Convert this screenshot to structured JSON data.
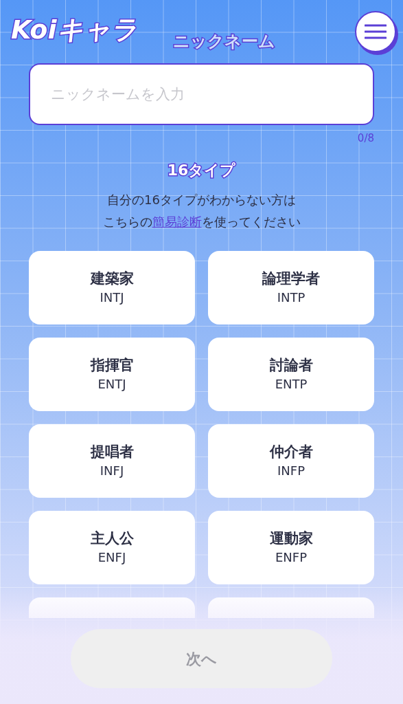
{
  "header": {
    "logo": "Koiキャラ",
    "title": "ニックネーム"
  },
  "nickname": {
    "placeholder": "ニックネームを入力",
    "counter": "0/8"
  },
  "type_section": {
    "title": "16タイプ",
    "line_1": "自分の16タイプがわからない方は",
    "line_2_before": "こちらの",
    "link": "簡易診断",
    "line_2_after": "を使ってください"
  },
  "types": [
    {
      "kind": "card",
      "name": "建築家",
      "code": "INTJ",
      "selected": false
    },
    {
      "kind": "card",
      "name": "論理学者",
      "code": "INTP",
      "selected": false
    },
    {
      "kind": "card",
      "name": "指揮官",
      "code": "ENTJ",
      "selected": false
    },
    {
      "kind": "card",
      "name": "討論者",
      "code": "ENTP",
      "selected": false
    },
    {
      "kind": "card",
      "name": "提唱者",
      "code": "INFJ",
      "selected": false
    },
    {
      "kind": "card",
      "name": "仲介者",
      "code": "INFP",
      "selected": false
    },
    {
      "kind": "card",
      "name": "主人公",
      "code": "ENFJ",
      "selected": false
    },
    {
      "kind": "card",
      "name": "運動家",
      "code": "ENFP",
      "selected": false
    },
    {
      "kind": "covered",
      "selected": false
    },
    {
      "kind": "covered",
      "selected": false
    }
  ],
  "next_button": {
    "label": "次へ",
    "disabled": true
  }
}
